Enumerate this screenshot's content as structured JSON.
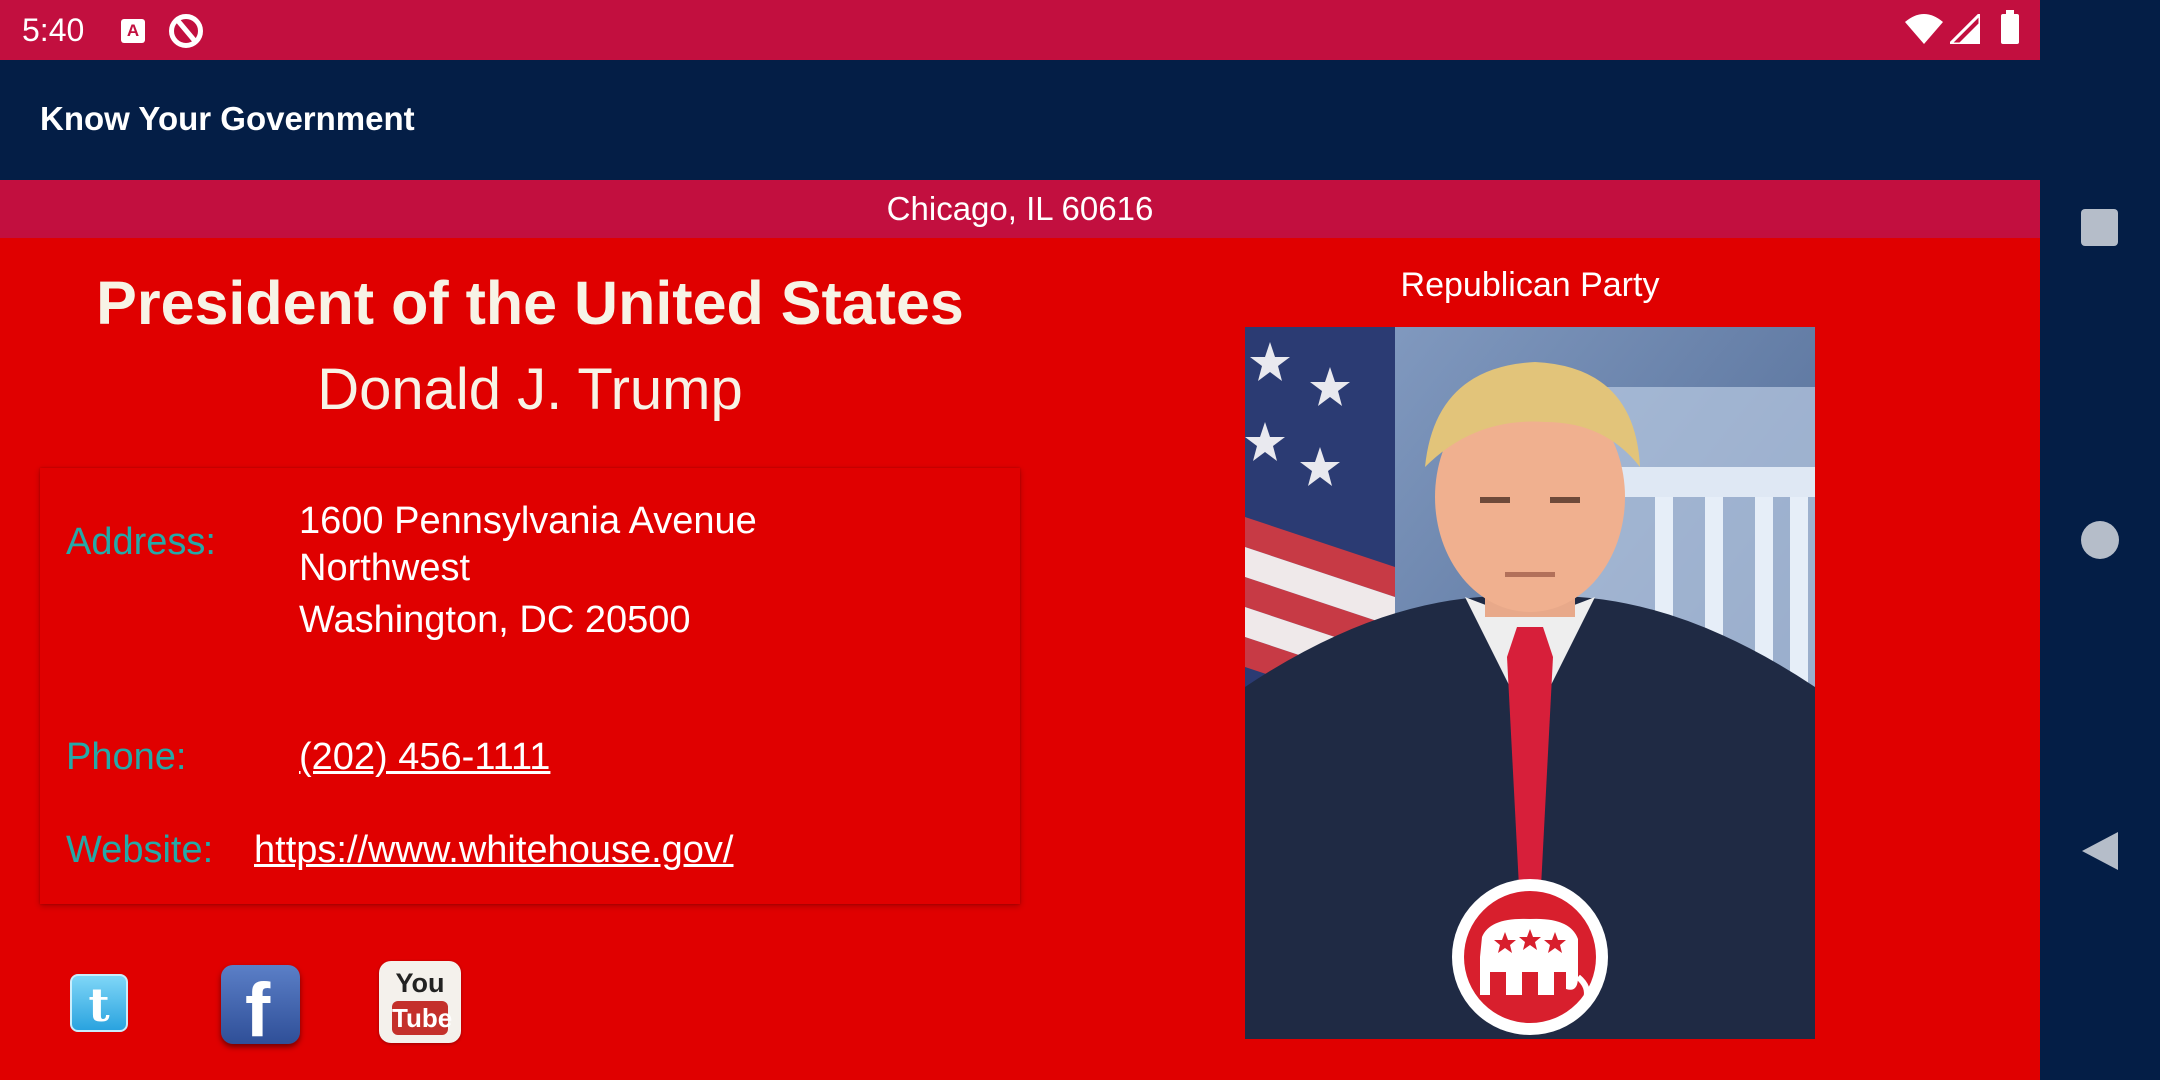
{
  "status_bar": {
    "time": "5:40",
    "icons": [
      "a-notification-icon",
      "sync-off-icon",
      "wifi-icon",
      "cell-signal-icon",
      "battery-icon"
    ]
  },
  "app_bar": {
    "title": "Know Your Government"
  },
  "location": {
    "text": "Chicago, IL 60616"
  },
  "official": {
    "office": "President of the United States",
    "name": "Donald J. Trump",
    "party": "Republican Party",
    "address_label": "Address:",
    "address_lines": [
      "1600 Pennsylvania Avenue",
      "Northwest",
      "Washington, DC 20500"
    ],
    "phone_label": "Phone:",
    "phone": "(202) 456-1111",
    "website_label": "Website:",
    "website": "https://www.whitehouse.gov/"
  },
  "social": [
    {
      "name": "twitter",
      "icon": "twitter-icon",
      "glyph": "t"
    },
    {
      "name": "facebook",
      "icon": "facebook-icon",
      "glyph": "f"
    },
    {
      "name": "youtube",
      "icon": "youtube-icon",
      "glyph_top": "You",
      "glyph_bottom": "Tube"
    }
  ],
  "colors": {
    "status_bar": "#c20f3f",
    "app_bar": "#041e46",
    "content_bg": "#e00000",
    "label_teal": "#25a9a8",
    "title_cream": "#f7f3e6"
  },
  "nav_bar": {
    "buttons": [
      "recents-square-icon",
      "home-circle-icon",
      "back-triangle-icon"
    ]
  }
}
